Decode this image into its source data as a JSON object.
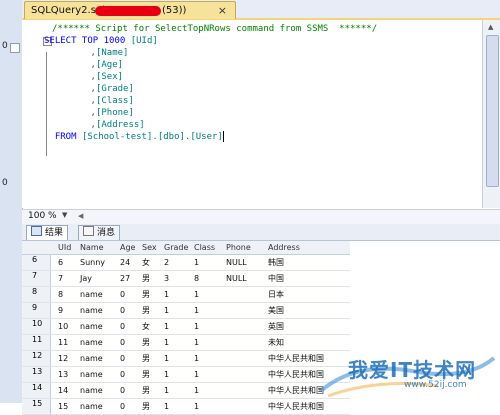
{
  "left_strip": {
    "nums": [
      "0",
      "0"
    ]
  },
  "tab": {
    "title_prefix": "SQLQuery2.sql -",
    "title_suffix": "(53))",
    "close_glyph": "×"
  },
  "editor": {
    "lines": [
      [
        {
          "t": "/****** Script for SelectTopNRows command from SSMS  ******/",
          "c": "cm"
        }
      ],
      [
        {
          "t": "SELECT TOP 1000 ",
          "c": "kw"
        },
        {
          "t": "[UId]",
          "c": "id"
        }
      ],
      [
        {
          "t": "      ,",
          "c": "pl"
        },
        {
          "t": "[Name]",
          "c": "id"
        }
      ],
      [
        {
          "t": "      ,",
          "c": "pl"
        },
        {
          "t": "[Age]",
          "c": "id"
        }
      ],
      [
        {
          "t": "      ,",
          "c": "pl"
        },
        {
          "t": "[Sex]",
          "c": "id"
        }
      ],
      [
        {
          "t": "      ,",
          "c": "pl"
        },
        {
          "t": "[Grade]",
          "c": "id"
        }
      ],
      [
        {
          "t": "      ,",
          "c": "pl"
        },
        {
          "t": "[Class]",
          "c": "id"
        }
      ],
      [
        {
          "t": "      ,",
          "c": "pl"
        },
        {
          "t": "[Phone]",
          "c": "id"
        }
      ],
      [
        {
          "t": "      ,",
          "c": "pl"
        },
        {
          "t": "[Address]",
          "c": "id"
        }
      ],
      [
        {
          "t": "  FROM ",
          "c": "kw"
        },
        {
          "t": "[School-test]",
          "c": "id"
        },
        {
          "t": ".",
          "c": "pl"
        },
        {
          "t": "[dbo]",
          "c": "id"
        },
        {
          "t": ".",
          "c": "pl"
        },
        {
          "t": "[User]",
          "c": "id"
        }
      ]
    ]
  },
  "zoom": {
    "value": "100 %"
  },
  "results_tabs": [
    {
      "label": "结果"
    },
    {
      "label": "消息"
    }
  ],
  "grid": {
    "columns": [
      "UId",
      "Name",
      "Age",
      "Sex",
      "Grade",
      "Class",
      "Phone",
      "Address"
    ],
    "rows": [
      {
        "n": "6",
        "cells": [
          "6",
          "Sunny",
          "24",
          "女",
          "2",
          "1",
          "NULL",
          "韩国"
        ]
      },
      {
        "n": "7",
        "cells": [
          "7",
          "Jay",
          "27",
          "男",
          "3",
          "8",
          "NULL",
          "中国"
        ]
      },
      {
        "n": "8",
        "cells": [
          "8",
          "name",
          "0",
          "男",
          "1",
          "1",
          "",
          "日本"
        ]
      },
      {
        "n": "9",
        "cells": [
          "9",
          "name",
          "0",
          "男",
          "1",
          "1",
          "",
          "美国"
        ]
      },
      {
        "n": "10",
        "cells": [
          "10",
          "name",
          "0",
          "女",
          "1",
          "1",
          "",
          "英国"
        ]
      },
      {
        "n": "11",
        "cells": [
          "11",
          "name",
          "0",
          "男",
          "1",
          "1",
          "",
          "未知"
        ]
      },
      {
        "n": "12",
        "cells": [
          "12",
          "name",
          "0",
          "男",
          "1",
          "1",
          "",
          "中华人民共和国"
        ]
      },
      {
        "n": "13",
        "cells": [
          "13",
          "name",
          "0",
          "男",
          "1",
          "1",
          "",
          "中华人民共和国"
        ]
      },
      {
        "n": "14",
        "cells": [
          "14",
          "name",
          "0",
          "男",
          "1",
          "1",
          "",
          "中华人民共和国"
        ]
      },
      {
        "n": "15",
        "cells": [
          "15",
          "name",
          "0",
          "男",
          "1",
          "1",
          "",
          "中华人民共和国"
        ]
      }
    ]
  },
  "watermark": {
    "text": "我爱IT技术网",
    "url": "www.52ij.com"
  },
  "colors": {
    "keyword": "#0000ff",
    "comment": "#008000",
    "identifier": "#008080",
    "tab_active": "#f7e29a",
    "redaction": "#e60012"
  }
}
